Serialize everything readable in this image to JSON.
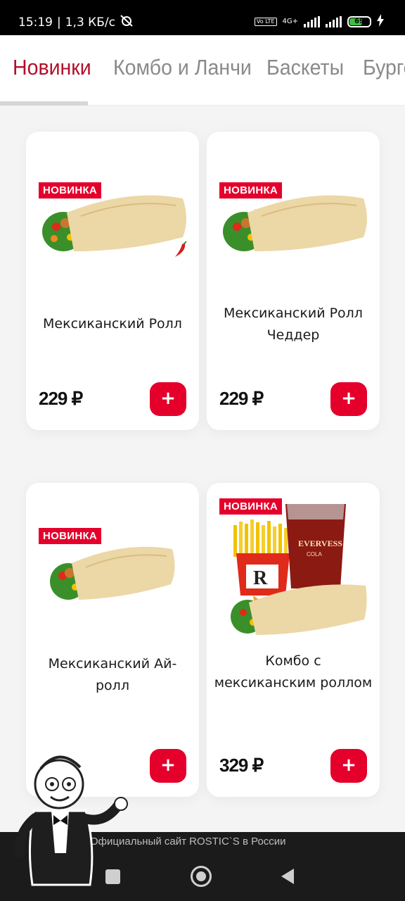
{
  "status_bar": {
    "time": "15:19",
    "separator": "|",
    "speed": "1,3 КБ/с",
    "network_label": "4G+",
    "volte_label": "Vo LTE",
    "battery_level": "69",
    "icons": [
      "alarm-off-icon",
      "signal-icon",
      "battery-icon",
      "charging-icon"
    ]
  },
  "tabs": [
    {
      "label": "Новинки",
      "active": true
    },
    {
      "label": "Комбо и Ланчи",
      "active": false
    },
    {
      "label": "Баскеты",
      "active": false
    },
    {
      "label": "Бурге",
      "active": false
    }
  ],
  "products": [
    {
      "badge": "НОВИНКА",
      "title": "Мексиканский Ролл",
      "price": "229 ₽",
      "add_label": "+",
      "spicy": true
    },
    {
      "badge": "НОВИНКА",
      "title": "Мексиканский Ролл Чеддер",
      "price": "229 ₽",
      "add_label": "+",
      "spicy": false
    },
    {
      "badge": "НОВИНКА",
      "title": "Мексиканский Ай-ролл",
      "price": "",
      "add_label": "+",
      "spicy": false
    },
    {
      "badge": "НОВИНКА",
      "title": "Комбо с мексиканским роллом",
      "price": "329 ₽",
      "add_label": "+",
      "spicy": false
    }
  ],
  "footer": {
    "caption": "Официальный сайт ROSTIC`S в России"
  },
  "colors": {
    "accent": "#e4002b",
    "tab_active": "#b0102a",
    "tab_inactive": "#8a8a8a"
  }
}
